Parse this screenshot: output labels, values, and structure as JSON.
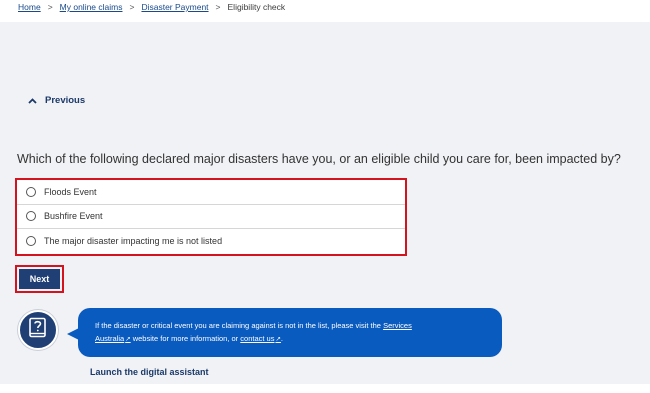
{
  "breadcrumb": {
    "items": [
      {
        "label": "Home"
      },
      {
        "label": "My online claims"
      },
      {
        "label": "Disaster Payment"
      }
    ],
    "current": "Eligibility check",
    "separator": ">"
  },
  "nav": {
    "previous_label": "Previous"
  },
  "question": {
    "text": "Which of the following declared major disasters have you, or an eligible child you care for, been impacted by?",
    "options": [
      {
        "label": "Floods Event"
      },
      {
        "label": "Bushfire Event"
      },
      {
        "label": "The major disaster impacting me is not listed"
      }
    ]
  },
  "actions": {
    "next_label": "Next"
  },
  "assistant": {
    "message_prefix": "If the disaster or critical event you are claiming against is not in the list, please visit the ",
    "link1_a": "Services",
    "link1_b": "Australia",
    "message_middle": " website for more information, or ",
    "link2": "contact us",
    "message_suffix": ".",
    "launch_label": "Launch the digital assistant"
  },
  "colors": {
    "accent": "#1f3f75",
    "highlight": "#d3131e",
    "bubble": "#0a5bbf"
  }
}
